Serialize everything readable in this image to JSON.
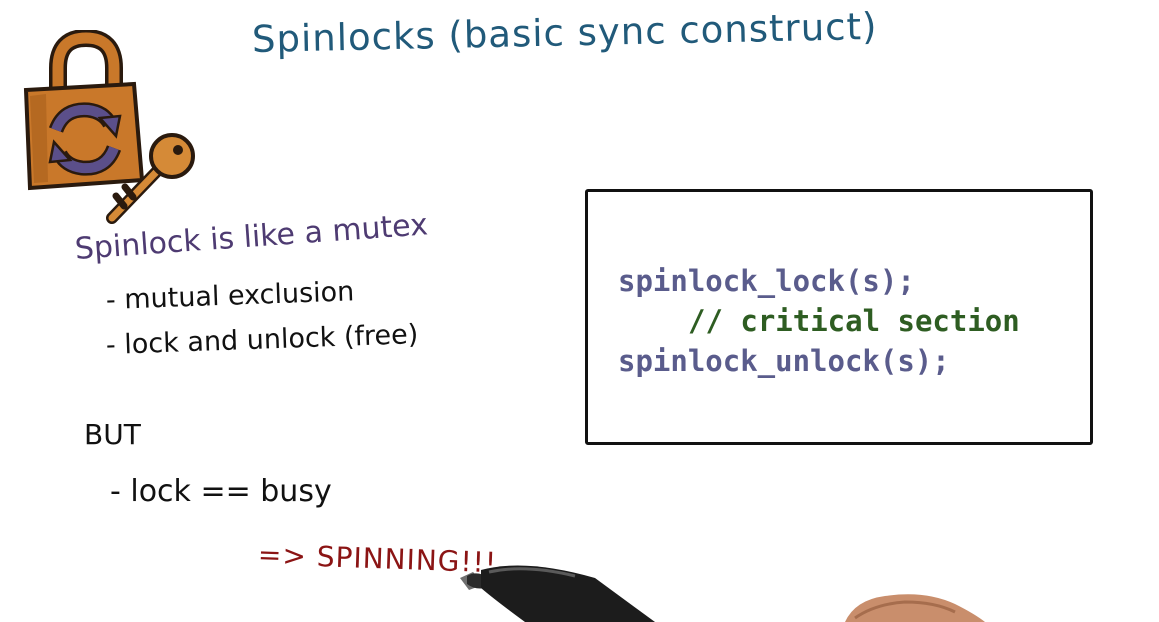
{
  "title": "Spinlocks (basic sync construct)",
  "intro": "Spinlock is like a mutex",
  "bullets": [
    "- mutual exclusion",
    "- lock and unlock (free)"
  ],
  "but_label": "BUT",
  "busy_line": "-   lock == busy",
  "spinning": "=> SPINNING!!!",
  "code": [
    "spinlock_lock(s);",
    "// critical section",
    "spinlock_unlock(s);"
  ],
  "colors": {
    "title": "#215a7a",
    "intro": "#4e3b72",
    "spinning": "#8b1414",
    "code_call": "#5a5c8c",
    "code_comment": "#2e5d22",
    "lock_body": "#c9782a",
    "lock_arrows": "#5b4f8a"
  },
  "icons": [
    "padlock-icon",
    "key-icon",
    "pen-hand"
  ]
}
